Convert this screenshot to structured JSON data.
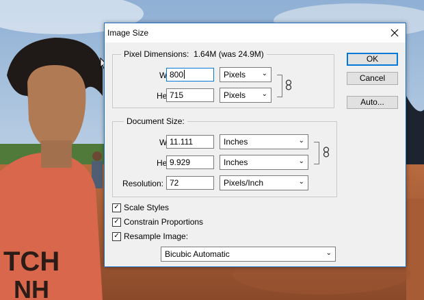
{
  "dialog": {
    "title": "Image Size",
    "close_icon": "close-icon"
  },
  "pixel_dimensions": {
    "legend": "Pixel Dimensions:",
    "summary": "1.64M (was 24.9M)",
    "width_label": "Width:",
    "width_value": "800",
    "width_unit": "Pixels",
    "height_label": "Height:",
    "height_value": "715",
    "height_unit": "Pixels"
  },
  "document_size": {
    "legend": "Document Size:",
    "width_label": "Width:",
    "width_value": "11.111",
    "width_unit": "Inches",
    "height_label": "Height:",
    "height_value": "9.929",
    "height_unit": "Inches",
    "resolution_label": "Resolution:",
    "resolution_value": "72",
    "resolution_unit": "Pixels/Inch"
  },
  "options": {
    "scale_styles": {
      "label": "Scale Styles",
      "checked": true
    },
    "constrain_proportions": {
      "label": "Constrain Proportions",
      "checked": true
    },
    "resample_image": {
      "label": "Resample Image:",
      "checked": true
    },
    "resample_method": "Bicubic Automatic"
  },
  "buttons": {
    "ok": "OK",
    "cancel": "Cancel",
    "auto": "Auto..."
  },
  "background_photo": {
    "shirt_text_1": "TCH",
    "shirt_text_2": "NH"
  }
}
